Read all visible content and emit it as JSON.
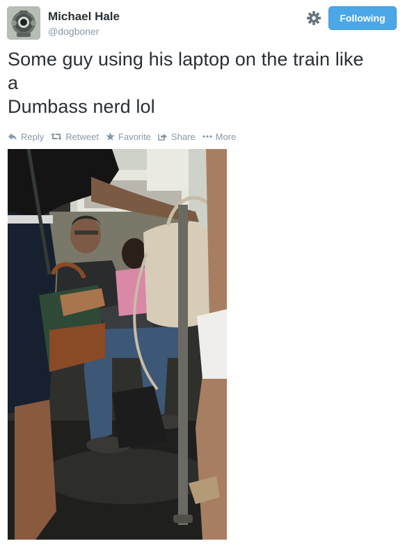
{
  "user": {
    "name": "Michael Hale",
    "handle": "@dogboner",
    "follow_label": "Following"
  },
  "tweet": {
    "text_line1": "Some guy using his laptop on the train like",
    "text_line2": "a",
    "text_line3": "Dumbass nerd lol"
  },
  "actions": [
    {
      "label": "Reply",
      "icon": "reply-icon"
    },
    {
      "label": "Retweet",
      "icon": "retweet-icon"
    },
    {
      "label": "Favorite",
      "icon": "star-icon"
    },
    {
      "label": "Share",
      "icon": "share-icon"
    },
    {
      "label": "More",
      "icon": "more-dots-icon"
    }
  ],
  "colors": {
    "follow_button": "#4ba7e8",
    "secondary_text": "#8899a6",
    "primary_text": "#292f33"
  }
}
